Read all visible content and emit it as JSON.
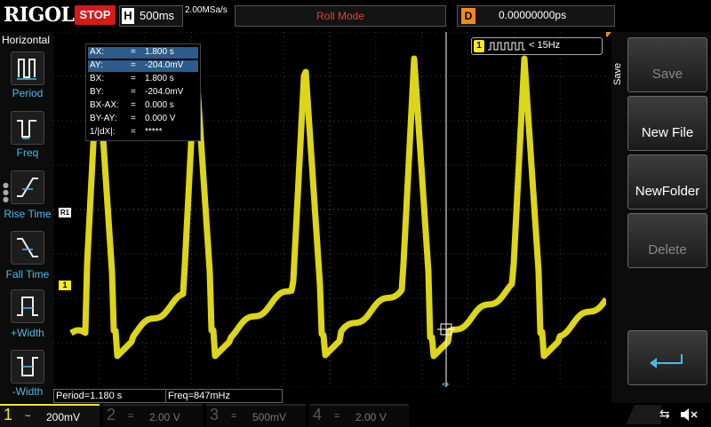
{
  "brand": "RIGOL",
  "status": "STOP",
  "timebase": {
    "label": "H",
    "value": "500ms"
  },
  "sample_rate": "2.00MSa/s",
  "mode": "Roll Mode",
  "delay": {
    "label": "D",
    "value": "0.00000000ps"
  },
  "left_menu": {
    "title": "Horizontal",
    "items": [
      {
        "label": "Period",
        "icon": "period-icon"
      },
      {
        "label": "Freq",
        "icon": "freq-icon"
      },
      {
        "label": "Rise Time",
        "icon": "rise-time-icon"
      },
      {
        "label": "Fall Time",
        "icon": "fall-time-icon"
      },
      {
        "label": "+Width",
        "icon": "pos-width-icon"
      },
      {
        "label": "-Width",
        "icon": "neg-width-icon"
      }
    ]
  },
  "cursor_table": [
    {
      "k": "AX:",
      "v": "1.800 s",
      "hl": true
    },
    {
      "k": "AY:",
      "v": "-204.0mV",
      "hl": true
    },
    {
      "k": "BX:",
      "v": "1.800 s",
      "hl": false
    },
    {
      "k": "BY:",
      "v": "-204.0mV",
      "hl": false
    },
    {
      "k": "BX-AX:",
      "v": "0.000 s",
      "hl": false
    },
    {
      "k": "BY-AY:",
      "v": "0.000 V",
      "hl": false
    },
    {
      "k": "1/|dX|:",
      "v": "*****",
      "hl": false
    }
  ],
  "cursor_eq": "=",
  "trigger": {
    "channel": "1",
    "value": "< 15Hz"
  },
  "markers": {
    "r1": "R1",
    "ch1": "1"
  },
  "right_menu": {
    "title": "Save",
    "buttons": [
      {
        "label": "Save",
        "enabled": false
      },
      {
        "label": "New File",
        "enabled": true
      },
      {
        "label": "NewFolder",
        "enabled": true
      },
      {
        "label": "Delete",
        "enabled": false
      }
    ]
  },
  "measurements": {
    "period": "Period=1.180 s",
    "freq": "Freq=847mHz"
  },
  "channels": [
    {
      "num": "1",
      "coupling": "~",
      "scale": "200mV",
      "color": "#f4ec1c",
      "active": true
    },
    {
      "num": "2",
      "coupling": "=",
      "scale": "2.00 V",
      "color": "#19a0e0",
      "active": false
    },
    {
      "num": "3",
      "coupling": "=",
      "scale": "500mV",
      "color": "#c81cc8",
      "active": false
    },
    {
      "num": "4",
      "coupling": "=",
      "scale": "2.00 V",
      "color": "#1c68d8",
      "active": false
    }
  ],
  "colors": {
    "ch1": "#f4ec1c",
    "accent": "#4fb7e8",
    "stop": "#d61a1a"
  }
}
